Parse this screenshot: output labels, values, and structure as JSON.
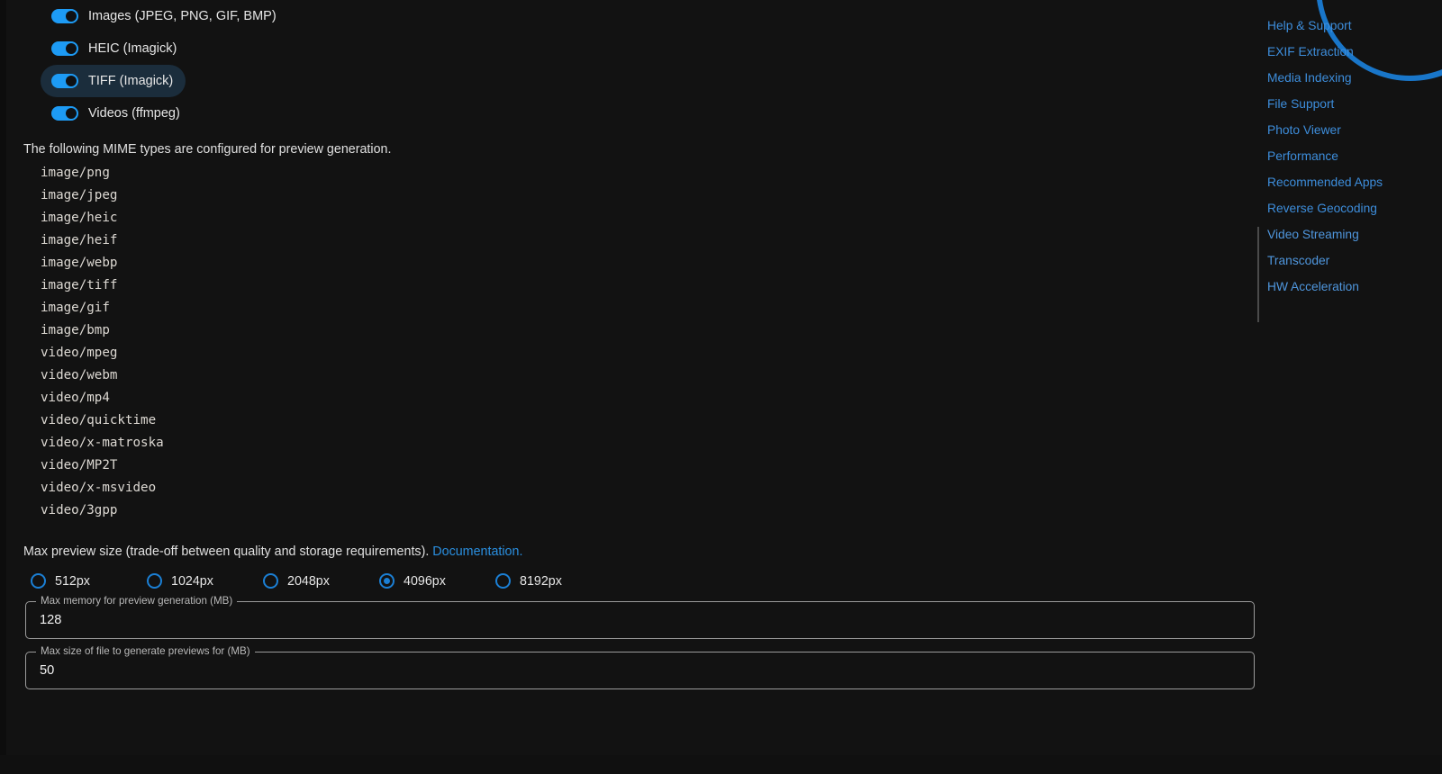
{
  "colors": {
    "background": "#121212",
    "accent_blue": "#1d9bf5",
    "link_blue": "#3d8ddb",
    "radio_blue": "#1b7fd4",
    "field_border": "#9b9b9b",
    "hover_pill": "#1b2d3c"
  },
  "toggles": [
    {
      "label": "Images (JPEG, PNG, GIF, BMP)",
      "on": true,
      "hovered": false,
      "name": "toggle-images"
    },
    {
      "label": "HEIC (Imagick)",
      "on": true,
      "hovered": false,
      "name": "toggle-heic"
    },
    {
      "label": "TIFF (Imagick)",
      "on": true,
      "hovered": true,
      "name": "toggle-tiff"
    },
    {
      "label": "Videos (ffmpeg)",
      "on": true,
      "hovered": false,
      "name": "toggle-videos"
    }
  ],
  "mime": {
    "intro": "The following MIME types are configured for preview generation.",
    "types": [
      "image/png",
      "image/jpeg",
      "image/heic",
      "image/heif",
      "image/webp",
      "image/tiff",
      "image/gif",
      "image/bmp",
      "video/mpeg",
      "video/webm",
      "video/mp4",
      "video/quicktime",
      "video/x-matroska",
      "video/MP2T",
      "video/x-msvideo",
      "video/3gpp"
    ]
  },
  "preview_size": {
    "description": "Max preview size (trade-off between quality and storage requirements).",
    "doc_link": "Documentation.",
    "options": [
      {
        "label": "512px",
        "selected": false
      },
      {
        "label": "1024px",
        "selected": false
      },
      {
        "label": "2048px",
        "selected": false
      },
      {
        "label": "4096px",
        "selected": true
      },
      {
        "label": "8192px",
        "selected": false
      }
    ],
    "selected_value": "4096px"
  },
  "fields": [
    {
      "label": "Max memory for preview generation (MB)",
      "value": "128",
      "name": "max-memory-field"
    },
    {
      "label": "Max size of file to generate previews for (MB)",
      "value": "50",
      "name": "max-file-size-field"
    }
  ],
  "sidebar": {
    "items": [
      {
        "label": "Help & Support",
        "active": false
      },
      {
        "label": "EXIF Extraction",
        "active": false
      },
      {
        "label": "Media Indexing",
        "active": false
      },
      {
        "label": "File Support",
        "active": false
      },
      {
        "label": "Photo Viewer",
        "active": false
      },
      {
        "label": "Performance",
        "active": false
      },
      {
        "label": "Recommended Apps",
        "active": false
      },
      {
        "label": "Reverse Geocoding",
        "active": false
      },
      {
        "label": "Video Streaming",
        "active": true
      },
      {
        "label": "Transcoder",
        "active": true
      },
      {
        "label": "HW Acceleration",
        "active": true
      }
    ]
  }
}
